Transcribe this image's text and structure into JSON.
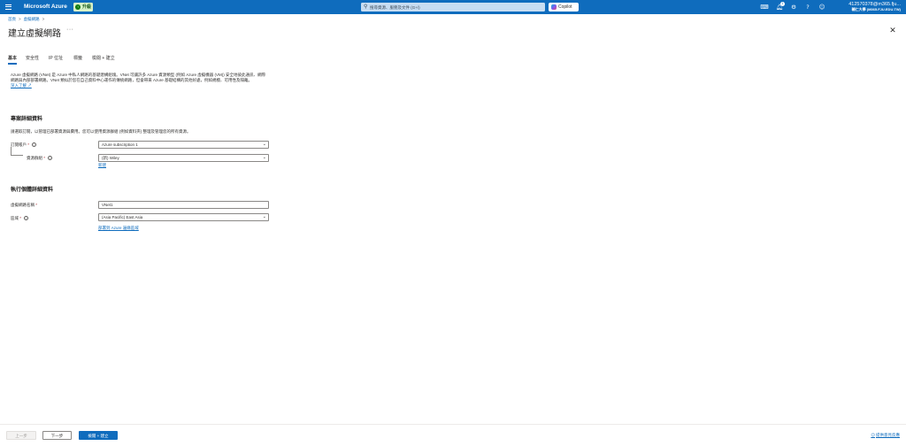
{
  "topbar": {
    "brand": "Microsoft Azure",
    "upgrade_label": "升級",
    "search_placeholder": "搜尋資源、服務及文件 (G+/)",
    "copilot_label": "Copilot",
    "notification_count": "1",
    "account_user": "412570378@m365.fju...",
    "account_org": "輔仁大學 (M365.FJU.EDU.TW)"
  },
  "breadcrumb": {
    "home": "首頁",
    "current": "虛擬網路"
  },
  "page": {
    "title": "建立虛擬網路",
    "more": "···"
  },
  "tabs": [
    "基本",
    "安全性",
    "IP 位址",
    "標籤",
    "檢閱 + 建立"
  ],
  "intro": {
    "text": "Azure 虛擬網路 (VNet) 是 Azure 中私人網路的基礎建構組塊。VNet 可讓許多 Azure 資源類型 (例如 Azure 虛擬機器 (VM)) 安全地彼此通訊、網際網路與內部部署網路。VNet 類似於您在自己資料中心運作的傳統網路，但會帶來 Azure 基礎結構的其他好處，例如規模、可用性及隔離。",
    "learn_more": "深入了解"
  },
  "project": {
    "title": "專案詳細資料",
    "description": "請選取訂閱，以管理已部署資源與費用。您可以使用資源群組 (例如資料夾) 整理及管理您的所有資源。",
    "subscription_label": "訂閱帳戶",
    "subscription_value": "Azure subscription 1",
    "resource_group_label": "資源群組",
    "resource_group_value": "(新) Wiley",
    "new_link": "新建"
  },
  "instance": {
    "title": "執行個體詳細資料",
    "vnet_name_label": "虛擬網路名稱",
    "vnet_name_value": "VNet1",
    "region_label": "區域",
    "region_value": "(Asia Pacific) East Asia",
    "deploy_link": "部署到 Azure 邊緣區域"
  },
  "footer": {
    "prev": "上一步",
    "next": "下一步",
    "review_create": "檢閱 + 建立",
    "feedback": "提供意見反應"
  },
  "required_mark": "*",
  "colors": {
    "azure_blue": "#0f6cbd",
    "upgrade_green": "#107c10"
  }
}
